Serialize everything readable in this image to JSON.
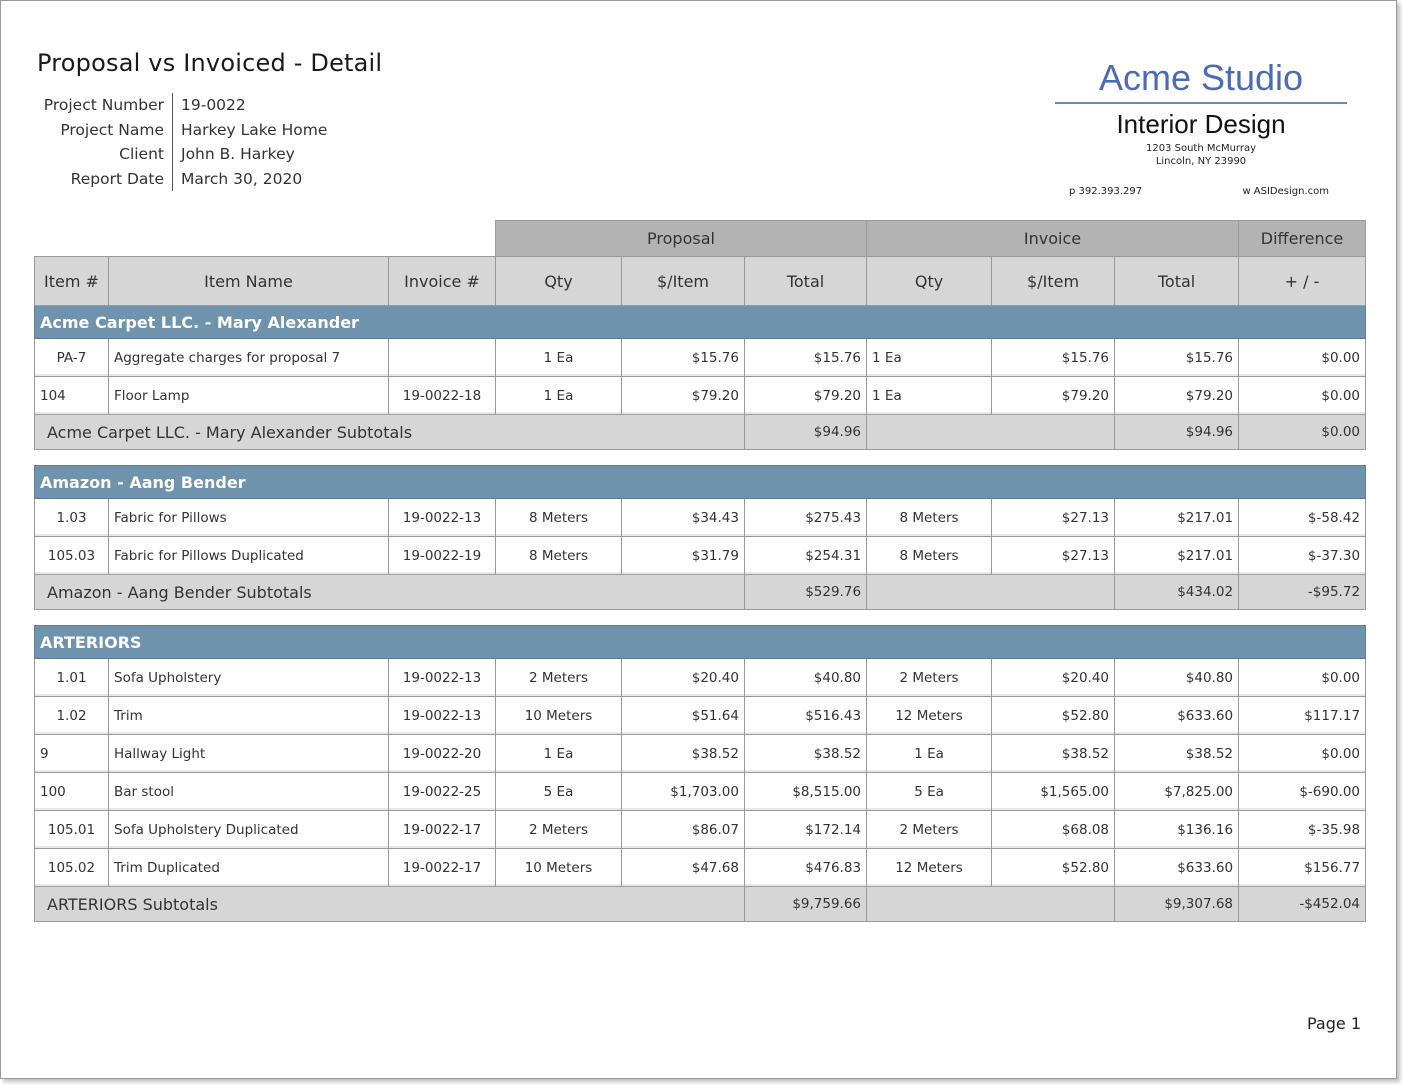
{
  "report": {
    "title": "Proposal vs Invoiced - Detail",
    "meta": [
      {
        "label": "Project Number",
        "value": "19-0022"
      },
      {
        "label": "Project Name",
        "value": "Harkey Lake Home"
      },
      {
        "label": "Client",
        "value": "John B. Harkey"
      },
      {
        "label": "Report Date",
        "value": "March 30, 2020"
      }
    ]
  },
  "brand": {
    "name": "Acme Studio",
    "subtitle": "Interior Design",
    "address_line1": "1203 South McMurray",
    "address_line2": "Lincoln, NY 23990",
    "phone": "p 392.393.297",
    "web": "w ASIDesign.com",
    "color": "#4b6bb5"
  },
  "table": {
    "group_headers": {
      "proposal": "Proposal",
      "invoice": "Invoice",
      "difference": "Difference"
    },
    "columns": {
      "item_no": "Item #",
      "item_name": "Item Name",
      "invoice_no": "Invoice #",
      "p_qty": "Qty",
      "p_per": "$/Item",
      "p_total": "Total",
      "i_qty": "Qty",
      "i_per": "$/Item",
      "i_total": "Total",
      "diff": "+ / -"
    },
    "sections": [
      {
        "name": "Acme Carpet LLC. - Mary Alexander",
        "rows": [
          {
            "item": "PA-7",
            "name": "Aggregate charges for proposal 7",
            "invoice": "",
            "p_qty": "1 Ea",
            "p_per": "$15.76",
            "p_total": "$15.76",
            "i_qty": "1 Ea",
            "i_per": "$15.76",
            "i_total": "$15.76",
            "diff": "$0.00"
          },
          {
            "item": "104",
            "name": "Floor Lamp",
            "invoice": "19-0022-18",
            "p_qty": "1 Ea",
            "p_per": "$79.20",
            "p_total": "$79.20",
            "i_qty": "1 Ea",
            "i_per": "$79.20",
            "i_total": "$79.20",
            "diff": "$0.00"
          }
        ],
        "subtotal_label": "Acme Carpet LLC. - Mary Alexander Subtotals",
        "subtotal_proposal": "$94.96",
        "subtotal_invoice": "$94.96",
        "subtotal_diff": "$0.00"
      },
      {
        "name": "Amazon - Aang Bender",
        "rows": [
          {
            "item": "1.03",
            "name": "Fabric for Pillows",
            "invoice": "19-0022-13",
            "p_qty": "8 Meters",
            "p_per": "$34.43",
            "p_total": "$275.43",
            "i_qty": "8 Meters",
            "i_per": "$27.13",
            "i_total": "$217.01",
            "diff": "$-58.42"
          },
          {
            "item": "105.03",
            "name": "Fabric for Pillows Duplicated",
            "invoice": "19-0022-19",
            "p_qty": "8 Meters",
            "p_per": "$31.79",
            "p_total": "$254.31",
            "i_qty": "8 Meters",
            "i_per": "$27.13",
            "i_total": "$217.01",
            "diff": "$-37.30"
          }
        ],
        "subtotal_label": "Amazon - Aang Bender Subtotals",
        "subtotal_proposal": "$529.76",
        "subtotal_invoice": "$434.02",
        "subtotal_diff": "-$95.72"
      },
      {
        "name": "ARTERIORS",
        "rows": [
          {
            "item": "1.01",
            "name": "Sofa Upholstery",
            "invoice": "19-0022-13",
            "p_qty": "2 Meters",
            "p_per": "$20.40",
            "p_total": "$40.80",
            "i_qty": "2 Meters",
            "i_per": "$20.40",
            "i_total": "$40.80",
            "diff": "$0.00"
          },
          {
            "item": "1.02",
            "name": "Trim",
            "invoice": "19-0022-13",
            "p_qty": "10 Meters",
            "p_per": "$51.64",
            "p_total": "$516.43",
            "i_qty": "12 Meters",
            "i_per": "$52.80",
            "i_total": "$633.60",
            "diff": "$117.17"
          },
          {
            "item": "9",
            "name": "Hallway Light",
            "invoice": "19-0022-20",
            "p_qty": "1 Ea",
            "p_per": "$38.52",
            "p_total": "$38.52",
            "i_qty": "1 Ea",
            "i_per": "$38.52",
            "i_total": "$38.52",
            "diff": "$0.00"
          },
          {
            "item": "100",
            "name": "Bar stool",
            "invoice": "19-0022-25",
            "p_qty": "5 Ea",
            "p_per": "$1,703.00",
            "p_total": "$8,515.00",
            "i_qty": "5 Ea",
            "i_per": "$1,565.00",
            "i_total": "$7,825.00",
            "diff": "$-690.00"
          },
          {
            "item": "105.01",
            "name": "Sofa Upholstery Duplicated",
            "invoice": "19-0022-17",
            "p_qty": "2 Meters",
            "p_per": "$86.07",
            "p_total": "$172.14",
            "i_qty": "2 Meters",
            "i_per": "$68.08",
            "i_total": "$136.16",
            "diff": "$-35.98"
          },
          {
            "item": "105.02",
            "name": "Trim Duplicated",
            "invoice": "19-0022-17",
            "p_qty": "10 Meters",
            "p_per": "$47.68",
            "p_total": "$476.83",
            "i_qty": "12 Meters",
            "i_per": "$52.80",
            "i_total": "$633.60",
            "diff": "$156.77"
          }
        ],
        "subtotal_label": "ARTERIORS  Subtotals",
        "subtotal_proposal": "$9,759.66",
        "subtotal_invoice": "$9,307.68",
        "subtotal_diff": "-$452.04"
      }
    ]
  },
  "colors": {
    "section_bar": "#6f93ad",
    "negative": "#c0392b",
    "header_gray": "#b3b3b3"
  },
  "footer": {
    "page": "Page 1"
  }
}
